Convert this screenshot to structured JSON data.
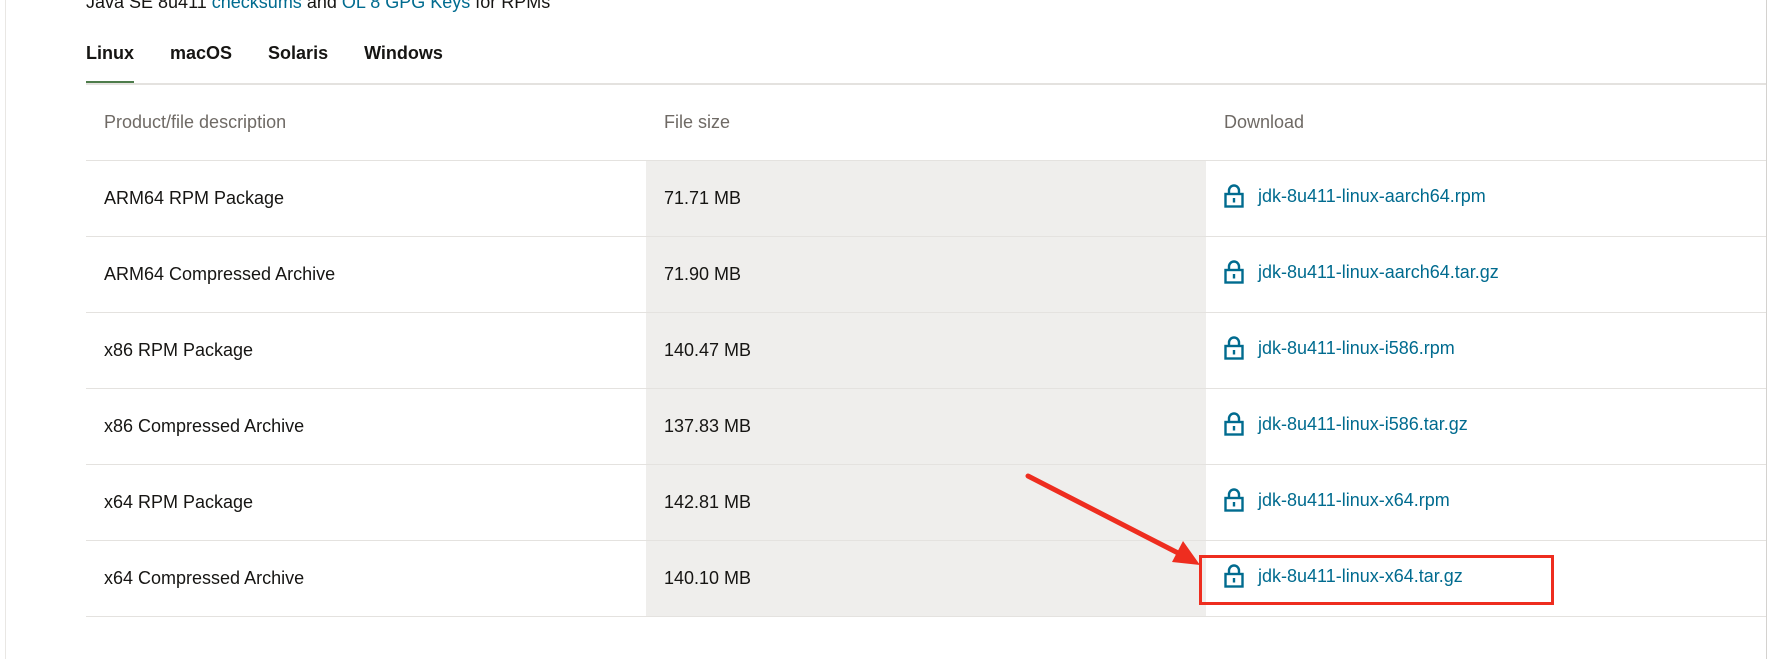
{
  "header": {
    "prefix": "Java SE 8u411",
    "checksums_link": "checksums",
    "and_text": "and",
    "gpg_link": "OL 8 GPG Keys",
    "suffix": "for RPMs"
  },
  "tabs": [
    {
      "label": "Linux",
      "active": true
    },
    {
      "label": "macOS",
      "active": false
    },
    {
      "label": "Solaris",
      "active": false
    },
    {
      "label": "Windows",
      "active": false
    }
  ],
  "table": {
    "columns": [
      "Product/file description",
      "File size",
      "Download"
    ],
    "rows": [
      {
        "description": "ARM64 RPM Package",
        "size": "71.71 MB",
        "file": "jdk-8u411-linux-aarch64.rpm"
      },
      {
        "description": "ARM64 Compressed Archive",
        "size": "71.90 MB",
        "file": "jdk-8u411-linux-aarch64.tar.gz"
      },
      {
        "description": "x86 RPM Package",
        "size": "140.47 MB",
        "file": "jdk-8u411-linux-i586.rpm"
      },
      {
        "description": "x86 Compressed Archive",
        "size": "137.83 MB",
        "file": "jdk-8u411-linux-i586.tar.gz"
      },
      {
        "description": "x64 RPM Package",
        "size": "142.81 MB",
        "file": "jdk-8u411-linux-x64.rpm"
      },
      {
        "description": "x64 Compressed Archive",
        "size": "140.10 MB",
        "file": "jdk-8u411-linux-x64.tar.gz"
      }
    ]
  },
  "colors": {
    "link": "#006b8f",
    "active_tab_underline": "#4d7c4b",
    "size_column_bg": "#efeeec",
    "annotation": "#ee2d1f"
  },
  "icons": {
    "download_lock": "lock-icon"
  }
}
